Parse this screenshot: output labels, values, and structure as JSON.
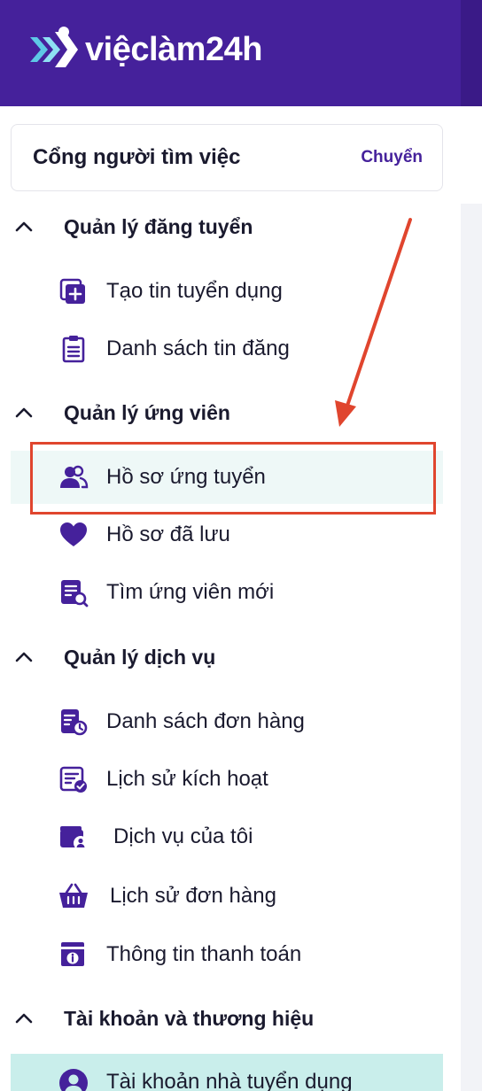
{
  "header": {
    "brand": "việclàm24h",
    "brand_color": "#45219b"
  },
  "portal": {
    "title": "Cổng người tìm việc",
    "switch_label": "Chuyển"
  },
  "sections": [
    {
      "label": "Quản lý đăng tuyển",
      "items": [
        {
          "label": "Tạo tin tuyển dụng",
          "icon": "add-square-icon"
        },
        {
          "label": "Danh sách tin đăng",
          "icon": "clipboard-list-icon"
        }
      ]
    },
    {
      "label": "Quản lý ứng viên",
      "items": [
        {
          "label": "Hồ sơ ứng tuyển",
          "icon": "users-icon",
          "active": true
        },
        {
          "label": "Hồ sơ đã lưu",
          "icon": "heart-icon"
        },
        {
          "label": "Tìm ứng viên mới",
          "icon": "document-search-icon"
        }
      ]
    },
    {
      "label": "Quản lý dịch vụ",
      "items": [
        {
          "label": "Danh sách đơn hàng",
          "icon": "order-clock-icon"
        },
        {
          "label": "Lịch sử kích hoạt",
          "icon": "list-check-icon"
        },
        {
          "label": "Dịch vụ của tôi",
          "icon": "wallet-user-icon"
        },
        {
          "label": "Lịch sử đơn hàng",
          "icon": "basket-icon"
        },
        {
          "label": "Thông tin thanh toán",
          "icon": "receipt-info-icon"
        }
      ]
    },
    {
      "label": "Tài khoản và thương hiệu",
      "items": [
        {
          "label": "Tài khoản nhà tuyển dụng",
          "icon": "user-circle-icon",
          "active": true
        }
      ]
    }
  ],
  "annotation": {
    "color": "#e0452e"
  }
}
